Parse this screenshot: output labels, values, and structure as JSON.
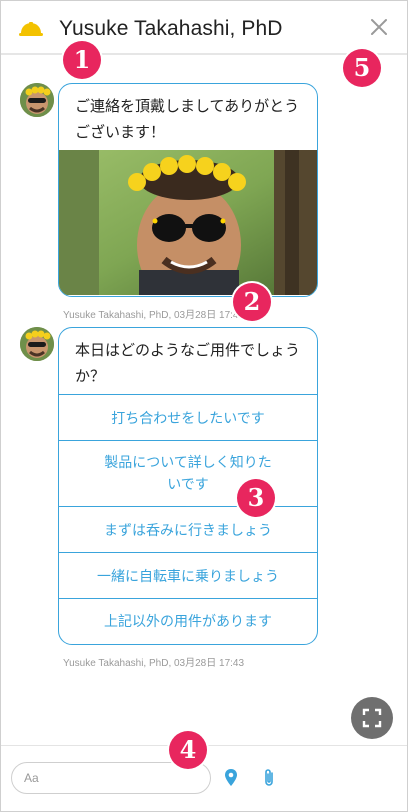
{
  "header": {
    "title": "Yusuke Takahashi, PhD",
    "logo_icon": "hard-hat-icon",
    "close_icon": "close-icon"
  },
  "callouts": [
    "1",
    "2",
    "3",
    "4",
    "5"
  ],
  "messages": [
    {
      "text": "ご連絡を頂戴しましてありがとうございます！",
      "has_image": true,
      "meta": "Yusuke Takahashi, PhD, 03月28日 17:43"
    },
    {
      "text": "本日はどのようなご用件でしょうか？",
      "choices": [
        "打ち合わせをしたいです",
        "製品について詳しく知りたいです",
        "まずは呑みに行きましょう",
        "一緒に自転車に乗りましょう",
        "上記以外の用件があります"
      ],
      "meta": "Yusuke Takahashi, PhD, 03月28日 17:43"
    }
  ],
  "composer": {
    "placeholder": "Aa",
    "location_icon": "location-pin-icon",
    "attach_icon": "paperclip-icon"
  },
  "expand_icon": "fullscreen-icon",
  "colors": {
    "accent": "#3aa4dc",
    "callout": "#e8265e",
    "logo": "#f3c200"
  }
}
